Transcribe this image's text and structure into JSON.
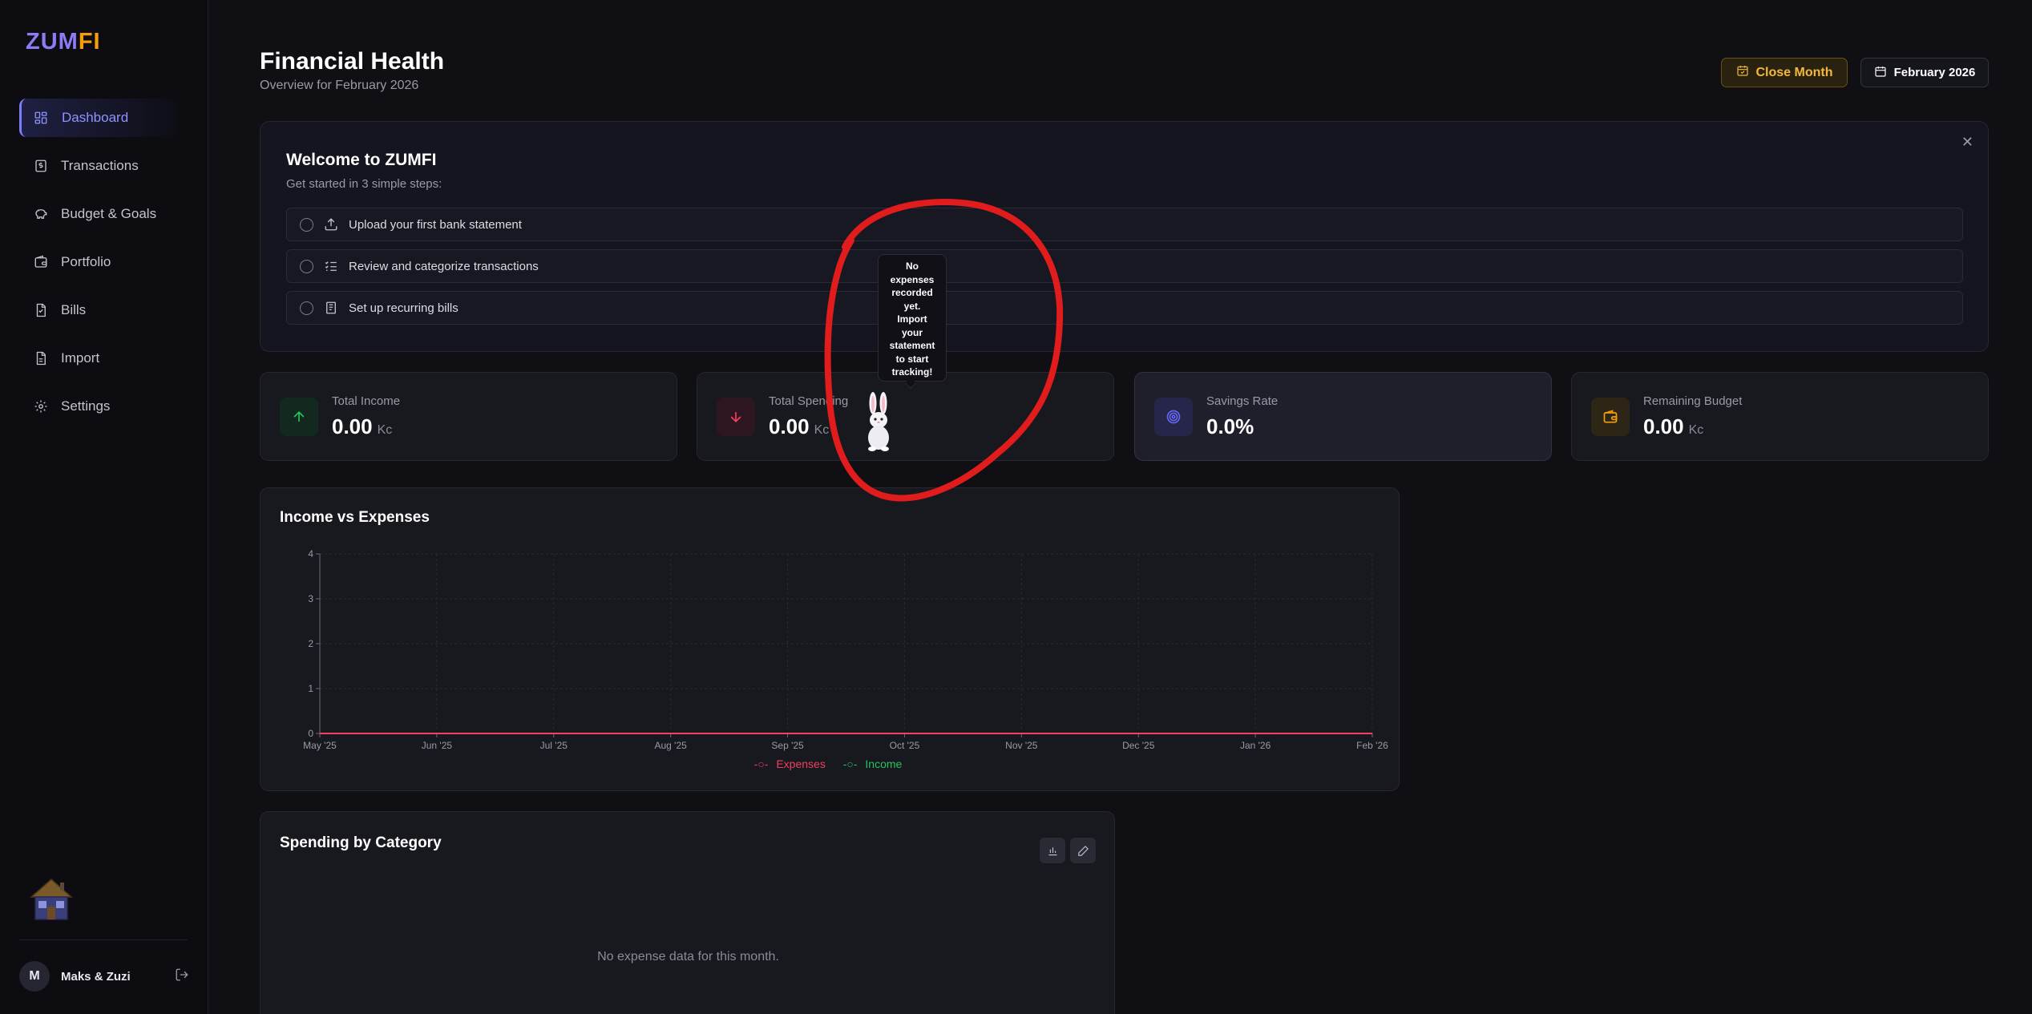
{
  "brand": {
    "logo_part1": "ZUM",
    "logo_part2": "FI"
  },
  "sidebar": {
    "items": [
      {
        "label": "Dashboard",
        "icon": "layout-grid-icon",
        "active": true
      },
      {
        "label": "Transactions",
        "icon": "dollar-receipt-icon"
      },
      {
        "label": "Budget & Goals",
        "icon": "piggy-bank-icon"
      },
      {
        "label": "Portfolio",
        "icon": "wallet-icon"
      },
      {
        "label": "Bills",
        "icon": "bill-icon"
      },
      {
        "label": "Import",
        "icon": "file-import-icon"
      },
      {
        "label": "Settings",
        "icon": "gear-icon"
      }
    ],
    "user": {
      "initial": "M",
      "name": "Maks & Zuzi"
    }
  },
  "header": {
    "title": "Financial Health",
    "subtitle": "Overview for February 2026",
    "close_month_label": "Close Month",
    "month_label": "February 2026"
  },
  "welcome": {
    "title": "Welcome to ZUMFI",
    "subtitle": "Get started in 3 simple steps:",
    "close_glyph": "✕",
    "steps": [
      {
        "label": "Upload your first bank statement",
        "icon": "upload-icon"
      },
      {
        "label": "Review and categorize transactions",
        "icon": "checklist-icon"
      },
      {
        "label": "Set up recurring bills",
        "icon": "receipt-icon"
      }
    ]
  },
  "stats": [
    {
      "label": "Total Income",
      "value": "0.00",
      "unit": "Kc",
      "icon": "arrow-up-icon",
      "color": "#22c55e"
    },
    {
      "label": "Total Spending",
      "value": "0.00",
      "unit": "Kc",
      "icon": "arrow-down-icon",
      "color": "#f43f5e"
    },
    {
      "label": "Savings Rate",
      "value": "0.0%",
      "unit": "",
      "icon": "target-icon",
      "color": "#6366f1"
    },
    {
      "label": "Remaining Budget",
      "value": "0.00",
      "unit": "Kc",
      "icon": "wallet-icon",
      "color": "#f59e0b"
    }
  ],
  "tooltip": {
    "lines": [
      "No",
      "expenses",
      "recorded",
      "yet.",
      "Import",
      "your",
      "statement",
      "to start",
      "tracking!"
    ]
  },
  "spending": {
    "title": "Spending by Category",
    "empty_message": "No expense data for this month."
  },
  "colors": {
    "expenses": "#f43f5e",
    "income": "#22c55e",
    "accent": "#8b7cf6",
    "annotation": "#e01c1c"
  },
  "chart_data": {
    "type": "line",
    "title": "Income vs Expenses",
    "categories": [
      "May '25",
      "Jun '25",
      "Jul '25",
      "Aug '25",
      "Sep '25",
      "Oct '25",
      "Nov '25",
      "Dec '25",
      "Jan '26",
      "Feb '26"
    ],
    "series": [
      {
        "name": "Expenses",
        "values": [
          0,
          0,
          0,
          0,
          0,
          0,
          0,
          0,
          0,
          0
        ],
        "color": "#f43f5e"
      },
      {
        "name": "Income",
        "values": [
          0,
          0,
          0,
          0,
          0,
          0,
          0,
          0,
          0,
          0
        ],
        "color": "#22c55e"
      }
    ],
    "ylim": [
      0,
      4
    ],
    "yticks": [
      0,
      1,
      2,
      3,
      4
    ],
    "grid": true,
    "legend": "bottom"
  }
}
